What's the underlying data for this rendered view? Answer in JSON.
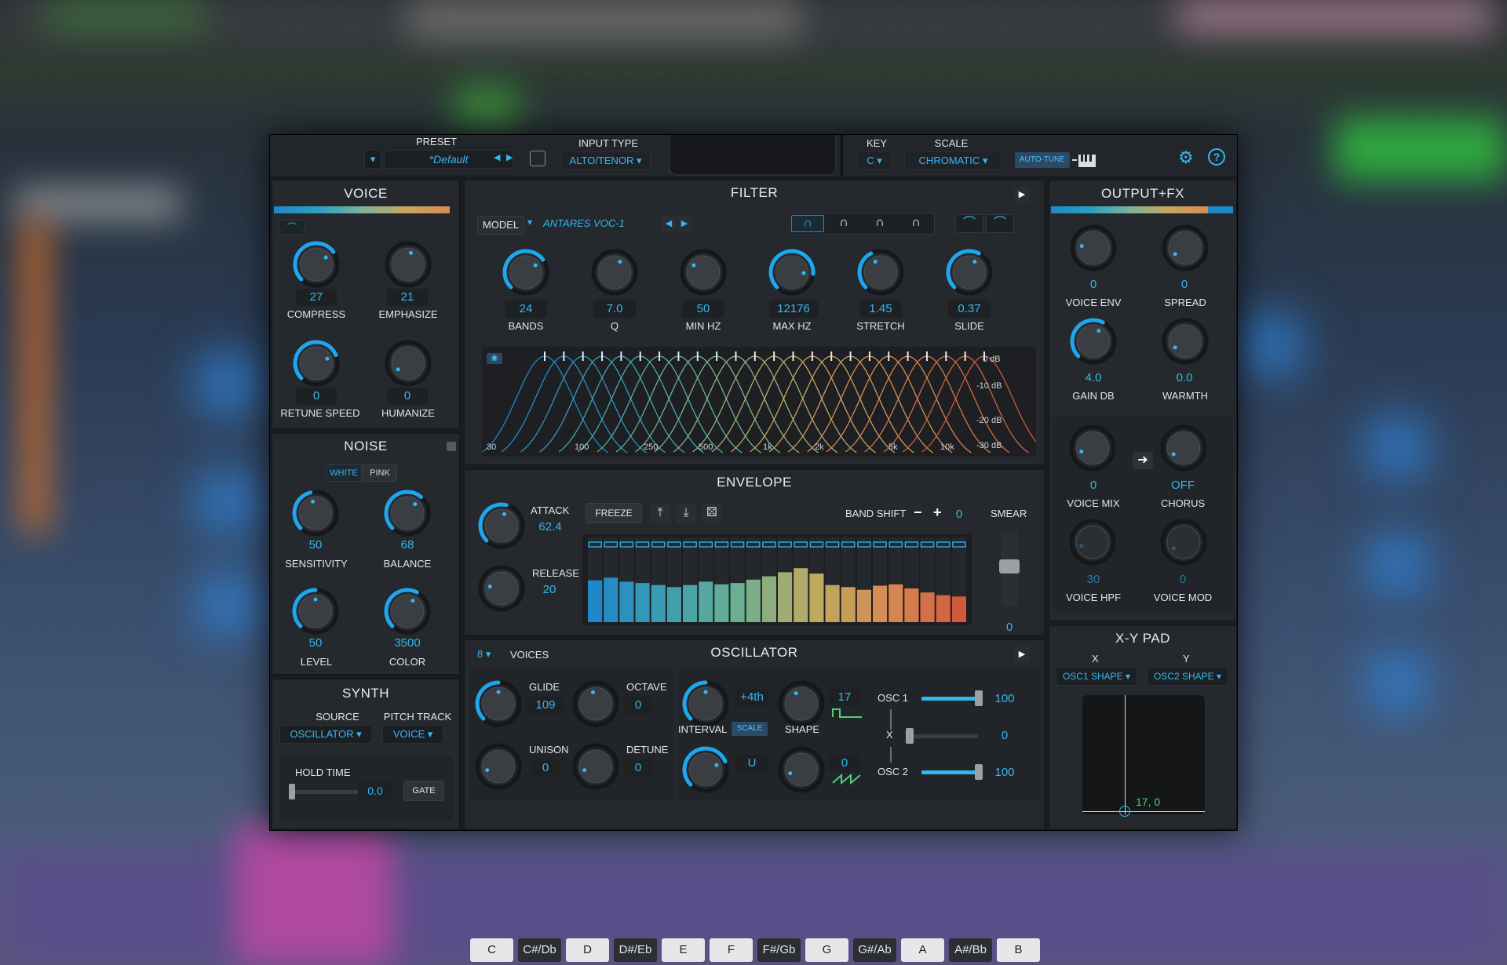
{
  "header": {
    "preset_label": "PRESET",
    "preset_value": "*Default",
    "input_type_label": "INPUT TYPE",
    "input_type_value": "ALTO/TENOR",
    "key_label": "KEY",
    "key_value": "C",
    "scale_label": "SCALE",
    "scale_value": "CHROMATIC",
    "autotune_label": "AUTO-TUNE"
  },
  "voice": {
    "title": "VOICE",
    "compress": {
      "label": "COMPRESS",
      "value": "27"
    },
    "emphasize": {
      "label": "EMPHASIZE",
      "value": "21"
    },
    "retune": {
      "label": "RETUNE SPEED",
      "value": "0"
    },
    "humanize": {
      "label": "HUMANIZE",
      "value": "0"
    }
  },
  "noise": {
    "title": "NOISE",
    "white": "WHITE",
    "pink": "PINK",
    "sensitivity": {
      "label": "SENSITIVITY",
      "value": "50"
    },
    "balance": {
      "label": "BALANCE",
      "value": "68"
    },
    "level": {
      "label": "LEVEL",
      "value": "50"
    },
    "color": {
      "label": "COLOR",
      "value": "3500"
    }
  },
  "synth": {
    "title": "SYNTH",
    "source_label": "SOURCE",
    "source_value": "OSCILLATOR",
    "pitch_label": "PITCH TRACK",
    "pitch_value": "VOICE",
    "hold_label": "HOLD TIME",
    "hold_value": "0.0",
    "gate": "GATE"
  },
  "filter": {
    "title": "FILTER",
    "model_label": "MODEL",
    "model_value": "ANTARES VOC-1",
    "bands": {
      "label": "BANDS",
      "value": "24"
    },
    "q": {
      "label": "Q",
      "value": "7.0"
    },
    "minhz": {
      "label": "MIN HZ",
      "value": "50"
    },
    "maxhz": {
      "label": "MAX HZ",
      "value": "12176"
    },
    "stretch": {
      "label": "STRETCH",
      "value": "1.45"
    },
    "slide": {
      "label": "SLIDE",
      "value": "0.37"
    },
    "db_ticks": [
      "0 dB",
      "-10 dB",
      "-20 dB",
      "-30 dB"
    ],
    "hz_ticks": [
      "30",
      "100",
      "250",
      "500",
      "1k",
      "2k",
      "5k",
      "10k"
    ]
  },
  "envelope": {
    "title": "ENVELOPE",
    "attack": {
      "label": "ATTACK",
      "value": "62.4"
    },
    "release": {
      "label": "RELEASE",
      "value": "20"
    },
    "freeze": "FREEZE",
    "band_shift_label": "BAND SHIFT",
    "band_shift_value": "0",
    "smear_label": "SMEAR",
    "smear_value": "0",
    "band_levels": [
      0.62,
      0.66,
      0.6,
      0.58,
      0.55,
      0.52,
      0.55,
      0.6,
      0.56,
      0.58,
      0.63,
      0.68,
      0.74,
      0.8,
      0.72,
      0.55,
      0.52,
      0.48,
      0.54,
      0.56,
      0.5,
      0.44,
      0.4,
      0.38
    ]
  },
  "oscillator": {
    "title": "OSCILLATOR",
    "voices_value": "8",
    "voices_label": "VOICES",
    "glide": {
      "label": "GLIDE",
      "value": "109"
    },
    "octave": {
      "label": "OCTAVE",
      "value": "0"
    },
    "unison": {
      "label": "UNISON",
      "value": "0"
    },
    "detune": {
      "label": "DETUNE",
      "value": "0"
    },
    "interval_label": "INTERVAL",
    "interval_value": "+4th",
    "interval_value2": "U",
    "scale_btn": "SCALE",
    "shape_label": "SHAPE",
    "shape1_value": "17",
    "shape2_value": "0",
    "osc1_label": "OSC 1",
    "osc1_value": "100",
    "x_label": "X",
    "x_value": "0",
    "osc2_label": "OSC 2",
    "osc2_value": "100"
  },
  "keys": [
    "C",
    "C#/Db",
    "D",
    "D#/Eb",
    "E",
    "F",
    "F#/Gb",
    "G",
    "G#/Ab",
    "A",
    "A#/Bb",
    "B"
  ],
  "output": {
    "title": "OUTPUT+FX",
    "voice_env": {
      "label": "VOICE  ENV",
      "value": "0"
    },
    "spread": {
      "label": "SPREAD",
      "value": "0"
    },
    "gain": {
      "label": "GAIN DB",
      "value": "4.0"
    },
    "warmth": {
      "label": "WARMTH",
      "value": "0.0"
    },
    "voice_mix": {
      "label": "VOICE MIX",
      "value": "0"
    },
    "chorus": {
      "label": "CHORUS",
      "value": "OFF"
    },
    "voice_hpf": {
      "label": "VOICE HPF",
      "value": "30"
    },
    "voice_mod": {
      "label": "VOICE MOD",
      "value": "0"
    }
  },
  "xypad": {
    "title": "X-Y PAD",
    "x_label": "X",
    "y_label": "Y",
    "x_value": "OSC1 SHAPE",
    "y_value": "OSC2 SHAPE",
    "readout": "17, 0"
  }
}
